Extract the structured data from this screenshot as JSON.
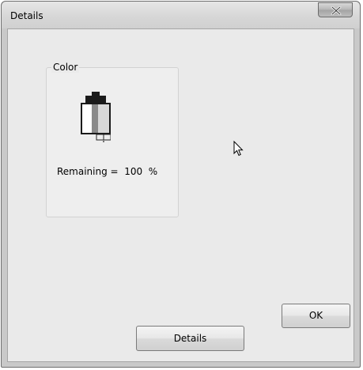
{
  "window": {
    "title": "Details",
    "close_icon": "close-x-icon"
  },
  "group": {
    "legend": "Color",
    "icon": "ink-cartridge-icon",
    "remaining_text": "Remaining =  100  %"
  },
  "buttons": {
    "ok_label": "OK",
    "details_label": "Details"
  },
  "colors": {
    "client_background": "#eaeaea",
    "titlebar": "#d6d6d6"
  },
  "cursor_icon": "mouse-pointer-icon"
}
